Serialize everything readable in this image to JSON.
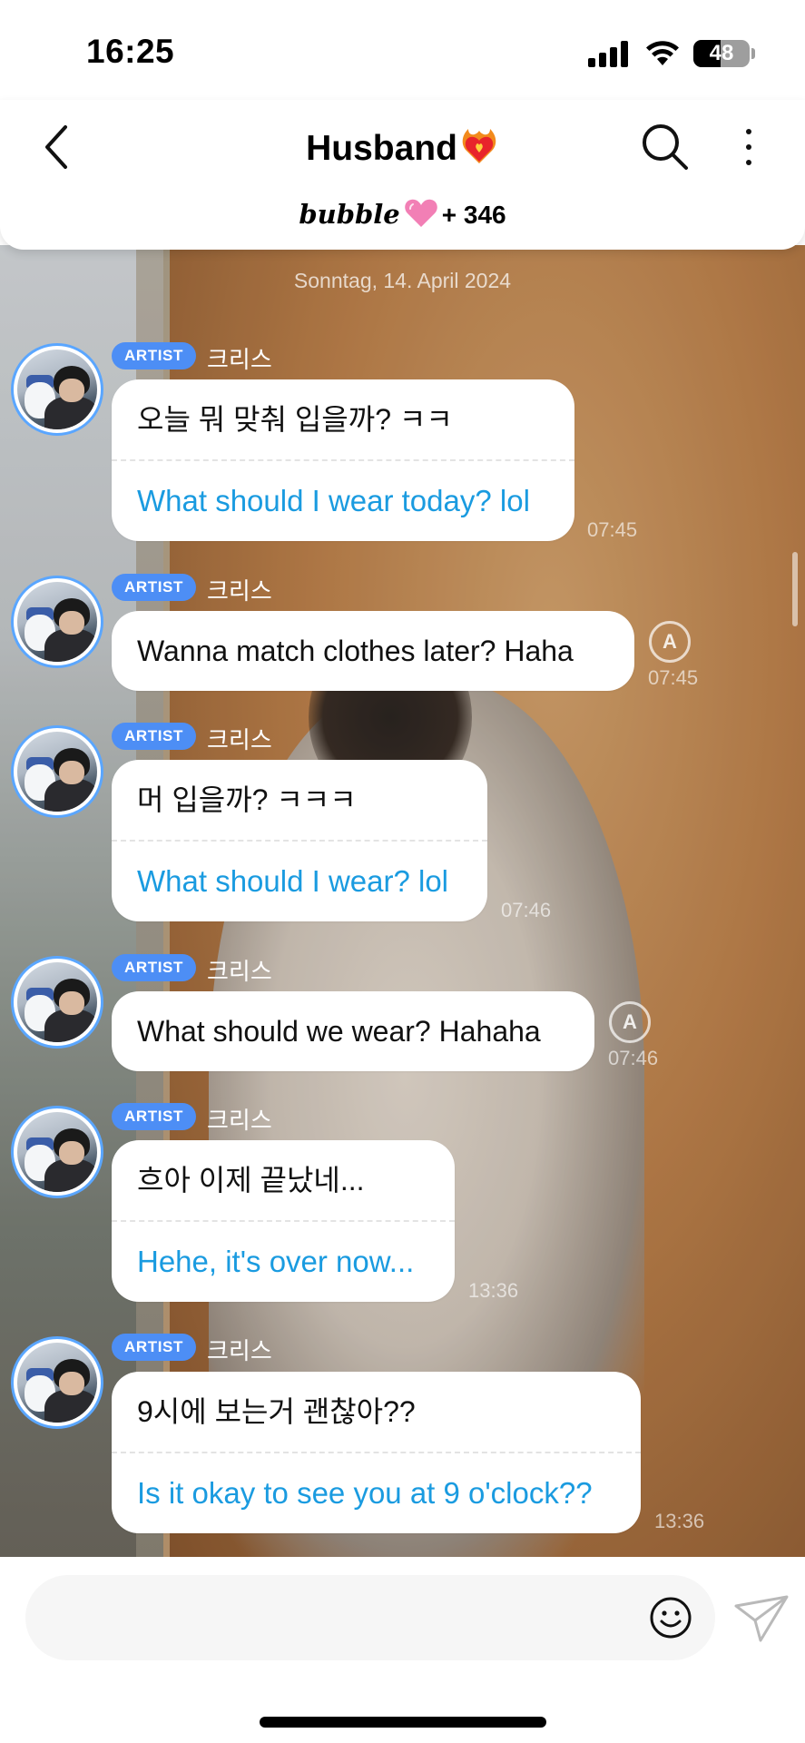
{
  "status_bar": {
    "time": "16:25",
    "battery_percent": 48,
    "battery_text": "48"
  },
  "header": {
    "title": "Husband",
    "title_emoji": "heart-on-fire",
    "subtitle_brand": "bubble",
    "subtitle_count": "+ 346"
  },
  "chat": {
    "date_separator": "Sonntag, 14. April 2024",
    "messages": [
      {
        "badge": "ARTIST",
        "sender": "크리스",
        "original": "오늘 뭐 맞춰 입을까? ㅋㅋ",
        "translation": "What should I wear today? lol",
        "time": "07:45",
        "has_translate_button": false
      },
      {
        "badge": "ARTIST",
        "sender": "크리스",
        "original": "Wanna match clothes later? Haha",
        "translation": "",
        "time": "07:45",
        "has_translate_button": true
      },
      {
        "badge": "ARTIST",
        "sender": "크리스",
        "original": "머 입을까? ㅋㅋㅋ",
        "translation": "What should I wear? lol",
        "time": "07:46",
        "has_translate_button": false
      },
      {
        "badge": "ARTIST",
        "sender": "크리스",
        "original": "What should we wear? Hahaha",
        "translation": "",
        "time": "07:46",
        "has_translate_button": true
      },
      {
        "badge": "ARTIST",
        "sender": "크리스",
        "original": "흐아 이제 끝났네...",
        "translation": "Hehe, it's over now...",
        "time": "13:36",
        "has_translate_button": false
      },
      {
        "badge": "ARTIST",
        "sender": "크리스",
        "original": "9시에 보는거 괜찮아??",
        "translation": "Is it okay to see you at 9 o'clock??",
        "time": "13:36",
        "has_translate_button": false
      }
    ],
    "translate_button_glyph": "A"
  },
  "composer": {
    "placeholder": "",
    "value": ""
  },
  "colors": {
    "badge": "#4d8ef5",
    "translation_text": "#1a9be0",
    "avatar_ring": "#5aa6ff"
  }
}
